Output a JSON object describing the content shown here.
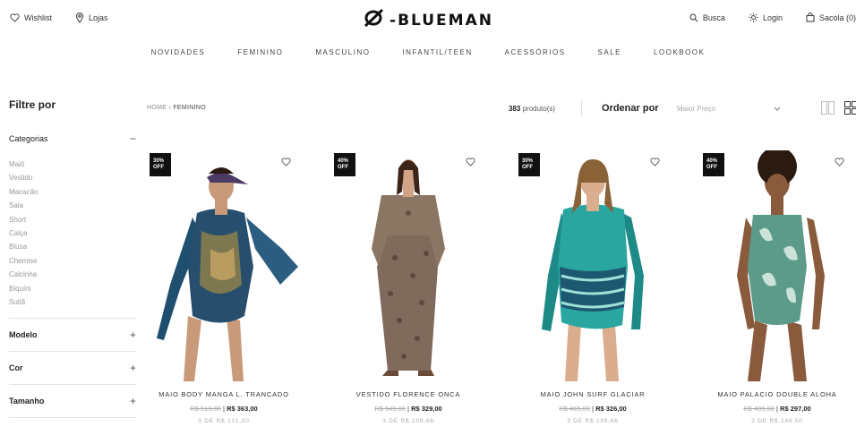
{
  "header": {
    "wishlist": "Wishlist",
    "stores": "Lojas",
    "brand": "BLUEMAN",
    "search": "Busca",
    "login": "Login",
    "cart": "Sacola (0)"
  },
  "nav": [
    "NOVIDADES",
    "FEMININO",
    "MASCULINO",
    "INFANTIL/TEEN",
    "ACESSÓRIOS",
    "SALE",
    "LOOKBOOK"
  ],
  "sidebar": {
    "title": "Filtre por",
    "categories_label": "Categorias",
    "categories": [
      "Maiô",
      "Vestido",
      "Macacão",
      "Saia",
      "Short",
      "Calça",
      "Blusa",
      "Chemise",
      "Calcinha",
      "Biquíni",
      "Sutiã"
    ],
    "sections": [
      "Modelo",
      "Cor",
      "Tamanho"
    ]
  },
  "toolbar": {
    "breadcrumb_home": "HOME",
    "breadcrumb_sep": "›",
    "breadcrumb_current": "FEMININO",
    "count_num": "383",
    "count_label": "produto(s)",
    "sort_label": "Ordenar por",
    "sort_value": "Maior Preço"
  },
  "products": [
    {
      "badge_pct": "30%",
      "badge_off": "OFF",
      "name": "MAIO BODY MANGA L. TRANCADO",
      "old": "R$ 519,00",
      "new": "R$ 363,00",
      "inst": "3 DE  R$ 121,00"
    },
    {
      "badge_pct": "40%",
      "badge_off": "OFF",
      "name": "VESTIDO FLORENCE ONCA",
      "old": "R$ 549,00",
      "new": "R$ 329,00",
      "inst": "3 DE  R$ 109,66"
    },
    {
      "badge_pct": "30%",
      "badge_off": "OFF",
      "name": "MAIO JOHN SURF GLACIAR",
      "old": "R$ 465,00",
      "new": "R$ 326,00",
      "inst": "3 DE  R$ 108,66"
    },
    {
      "badge_pct": "40%",
      "badge_off": "OFF",
      "name": "MAIO PALACIO DOUBLE ALOHA",
      "old": "R$ 495,00",
      "new": "R$ 297,00",
      "inst": "2 DE  R$ 148,50"
    }
  ],
  "colors": {
    "accent": "#111111",
    "muted": "#aaaaaa"
  },
  "icons": [
    "heart-icon",
    "pin-icon",
    "search-icon",
    "sun-icon",
    "bag-icon",
    "grid-2-icon",
    "grid-4-icon",
    "chevron-down-icon"
  ]
}
